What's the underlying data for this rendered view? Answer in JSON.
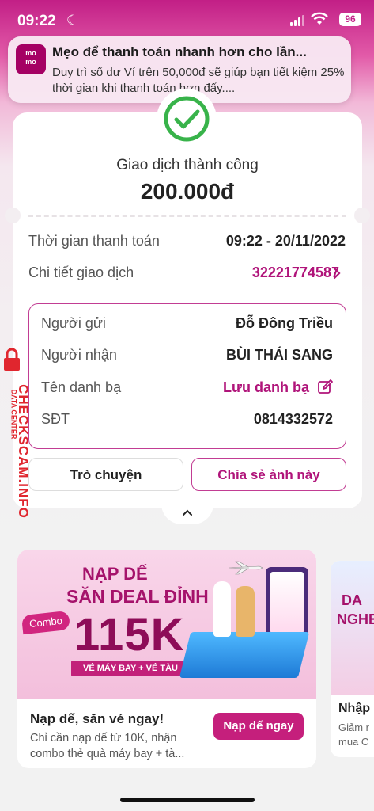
{
  "status_bar": {
    "time": "09:22",
    "battery": "96"
  },
  "notification": {
    "app_logo": "momo",
    "title": "Mẹo để thanh toán nhanh hơn cho lần...",
    "body": "Duy trì số dư Ví trên 50,000đ sẽ giúp bạn tiết kiệm 25% thời gian khi thanh toán hơn đấy...."
  },
  "transaction": {
    "status": "Giao dịch thành công",
    "amount": "200.000đ",
    "time_label": "Thời gian thanh toán",
    "time_value": "09:22 - 20/11/2022",
    "detail_label": "Chi tiết giao dịch",
    "detail_value": "32221774587",
    "sender_label": "Người gửi",
    "sender_value": "Đỗ Đông Triều",
    "receiver_label": "Người nhận",
    "receiver_value": "BÙI THÁI SANG",
    "contact_label": "Tên danh bạ",
    "contact_value": "Lưu danh bạ",
    "phone_label": "SĐT",
    "phone_value": "0814332572"
  },
  "actions": {
    "chat": "Trò chuyện",
    "share": "Chia sẻ ảnh này"
  },
  "promo": {
    "line1": "NẠP DẾ",
    "line2": "SĂN DEAL ĐỈNH",
    "combo": "Combo",
    "big": "115K",
    "strip": "VÉ MÁY BAY + VÉ TÀU",
    "title": "Nạp dế, săn vé ngay!",
    "desc": "Chỉ cần nạp dế từ 10K, nhận combo thẻ quà máy bay + tà...",
    "button": "Nạp dế ngay"
  },
  "promo2": {
    "line1": "DA",
    "line2": "NGHE",
    "title": "Nhập",
    "desc1": "Giảm r",
    "desc2": "mua C"
  },
  "watermark": {
    "main": "CHECKSCAM.INFO",
    "sub": "DATA CENTER"
  }
}
